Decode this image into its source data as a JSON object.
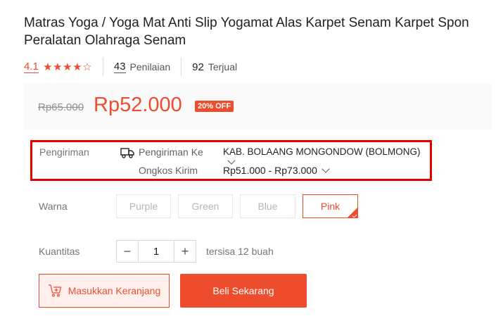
{
  "product": {
    "title": "Matras Yoga / Yoga Mat Anti Slip Yogamat Alas Karpet Senam Karpet Spon Peralatan Olahraga Senam",
    "rating": "4.1",
    "stars_filled": 4,
    "stars_total": 5,
    "review_count": "43",
    "review_label": "Penilaian",
    "sold_count": "92",
    "sold_label": "Terjual"
  },
  "price": {
    "original": "Rp65.000",
    "current": "Rp52.000",
    "discount": "20% OFF"
  },
  "shipping": {
    "label": "Pengiriman",
    "to_label": "Pengiriman Ke",
    "to_value": "KAB. BOLAANG MONGONDOW (BOLMONG)",
    "cost_label": "Ongkos Kirim",
    "cost_value": "Rp51.000 - Rp73.000"
  },
  "variants": {
    "label": "Warna",
    "options": [
      "Purple",
      "Green",
      "Blue",
      "Pink"
    ],
    "selected": "Pink"
  },
  "quantity": {
    "label": "Kuantitas",
    "minus": "−",
    "value": "1",
    "plus": "+",
    "stock": "tersisa 12 buah"
  },
  "actions": {
    "add_to_cart": "Masukkan Keranjang",
    "buy_now": "Beli Sekarang"
  },
  "colors": {
    "accent": "#ee4d2d",
    "highlight_border": "#e00000"
  },
  "icons": {
    "truck": "truck-icon",
    "cart": "add-to-cart-icon",
    "chevron": "chevron-down-icon"
  }
}
